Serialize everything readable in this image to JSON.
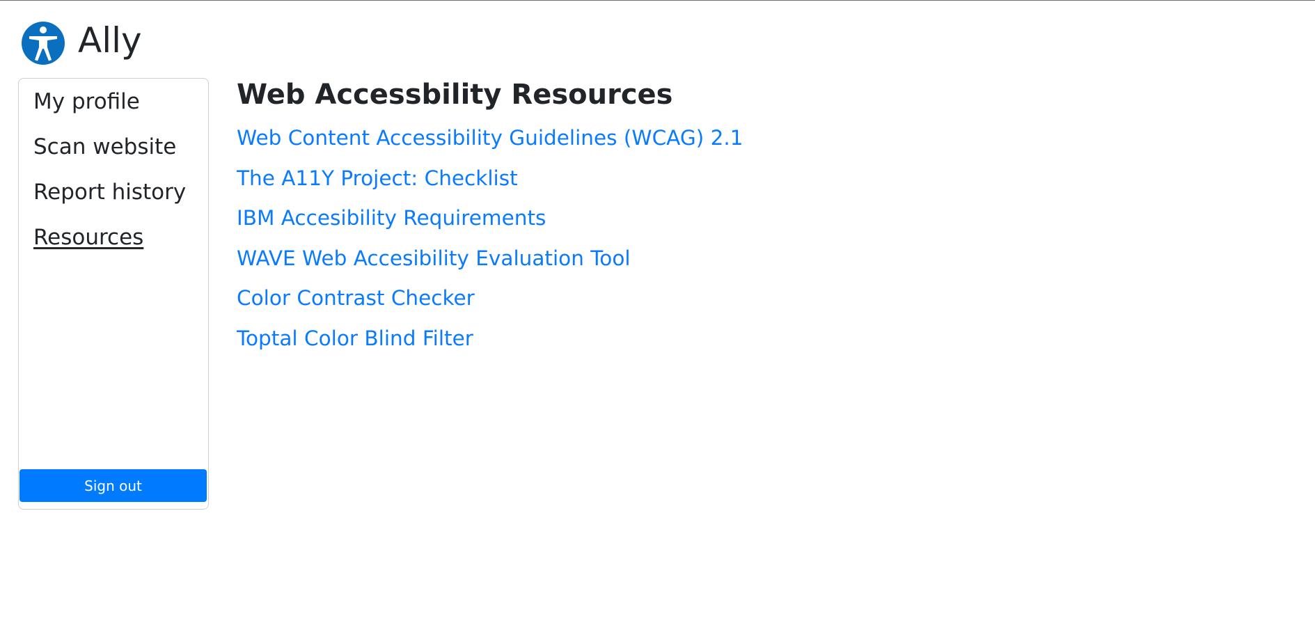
{
  "brand": {
    "name": "Ally",
    "logo_icon": "accessibility-icon",
    "logo_color": "#0a6fbf"
  },
  "sidebar": {
    "items": [
      {
        "label": "My profile",
        "active": false
      },
      {
        "label": "Scan website",
        "active": false
      },
      {
        "label": "Report history",
        "active": false
      },
      {
        "label": "Resources",
        "active": true
      }
    ],
    "signout_label": "Sign out"
  },
  "main": {
    "title": "Web Accessbility Resources",
    "resources": [
      {
        "label": "Web Content Accessibility Guidelines (WCAG) 2.1"
      },
      {
        "label": "The A11Y Project: Checklist"
      },
      {
        "label": "IBM Accesibility Requirements"
      },
      {
        "label": "WAVE Web Accesibility Evaluation Tool"
      },
      {
        "label": "Color Contrast Checker"
      },
      {
        "label": "Toptal Color Blind Filter"
      }
    ]
  },
  "colors": {
    "link": "#0a7bff",
    "button": "#007bff",
    "text": "#212529"
  }
}
